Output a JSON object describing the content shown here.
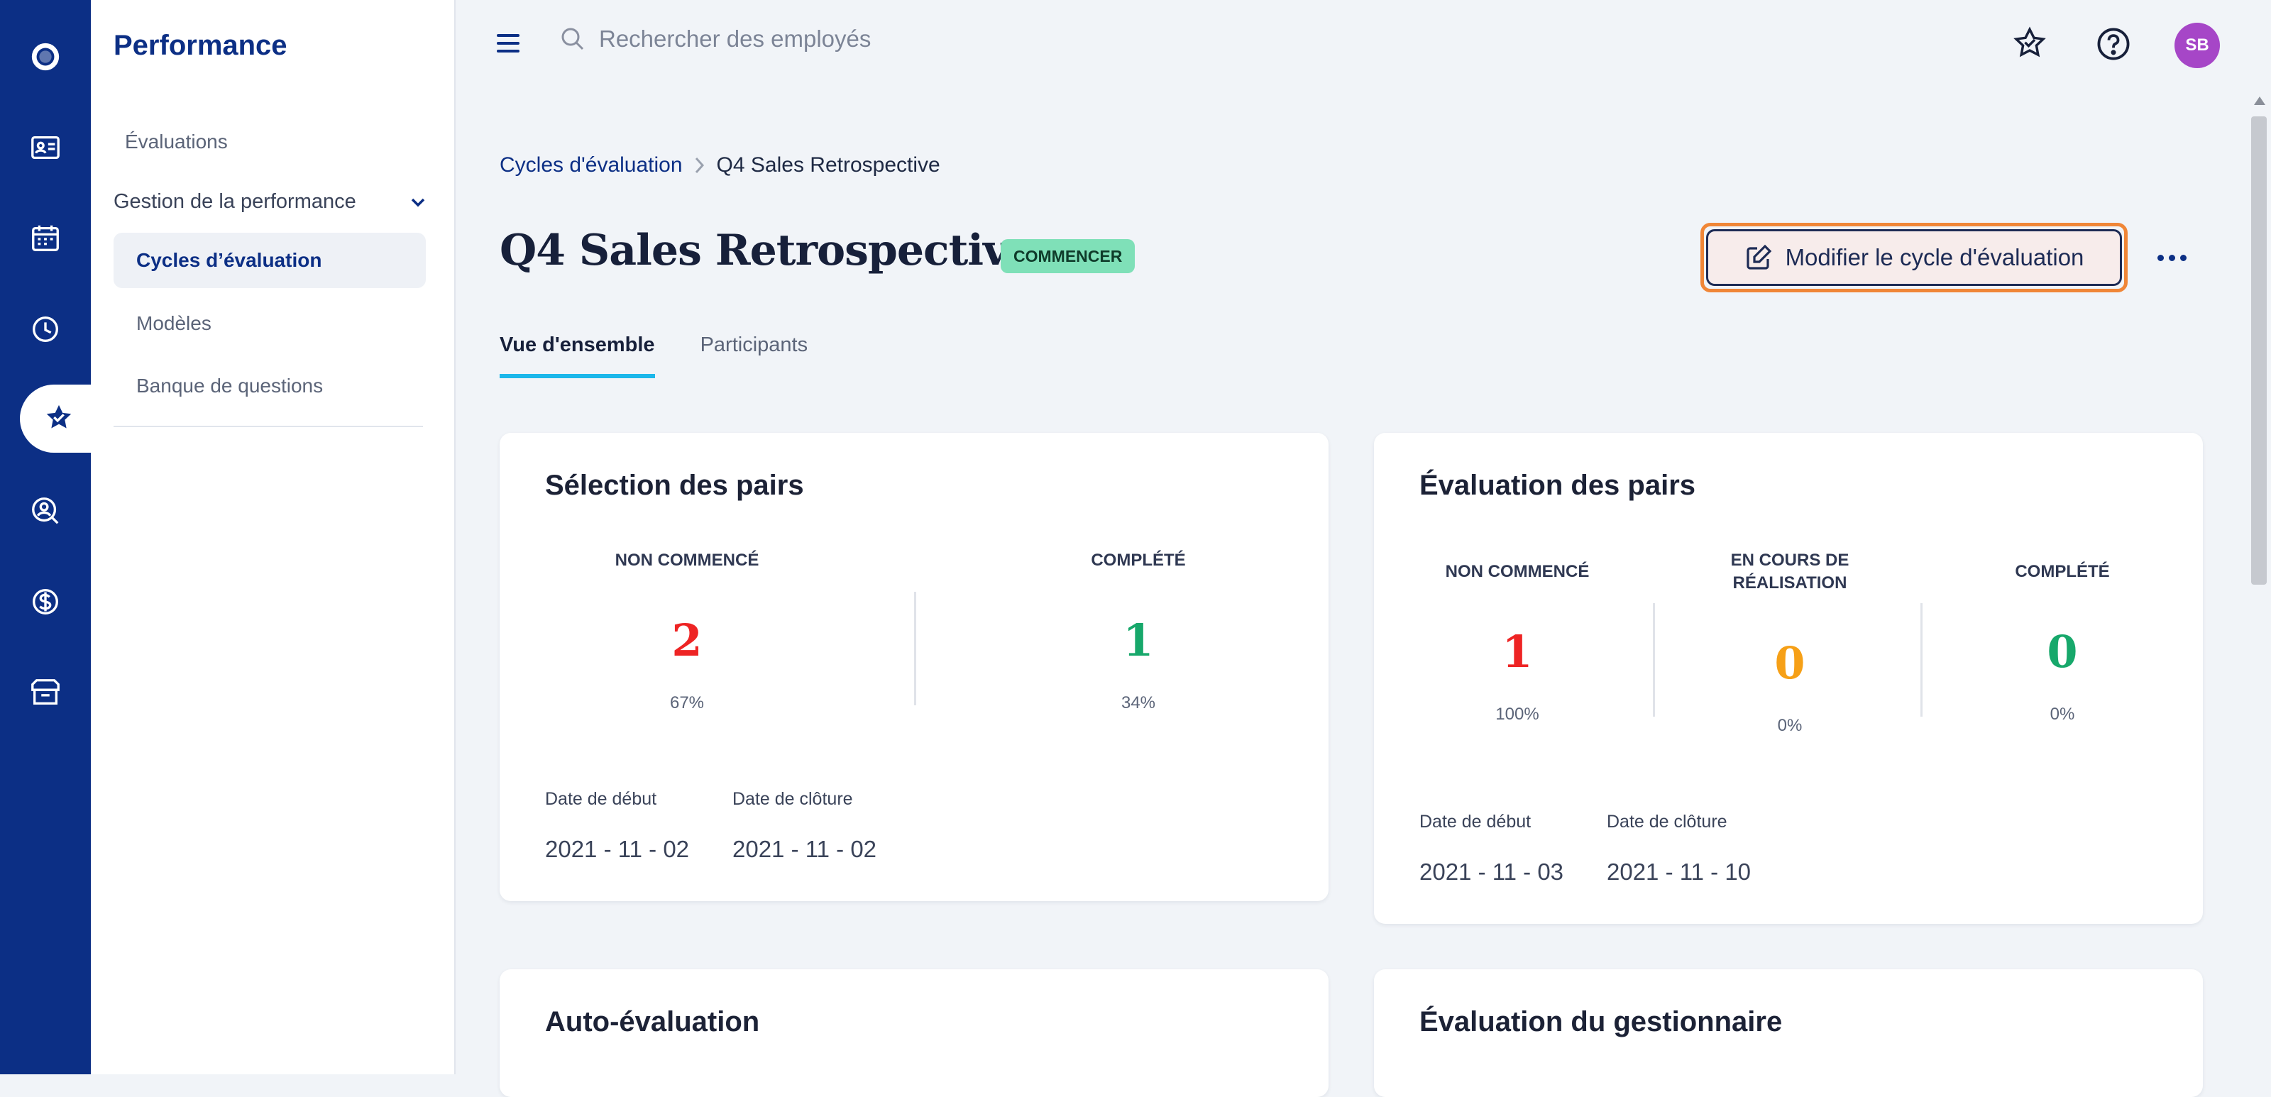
{
  "sidebar": {
    "title": "Performance",
    "items": [
      {
        "label": "Évaluations"
      },
      {
        "label": "Gestion de la performance"
      },
      {
        "label": "Cycles d’évaluation"
      },
      {
        "label": "Modèles"
      },
      {
        "label": "Banque de questions"
      }
    ]
  },
  "topbar": {
    "search_placeholder": "Rechercher des employés",
    "avatar_initials": "SB"
  },
  "breadcrumb": {
    "parent": "Cycles d'évaluation",
    "current": "Q4 Sales Retrospective"
  },
  "page": {
    "title": "Q4 Sales Retrospective",
    "status": "COMMENCER",
    "edit_button": "Modifier le cycle d'évaluation"
  },
  "tabs": [
    {
      "label": "Vue d'ensemble"
    },
    {
      "label": "Participants"
    }
  ],
  "cards": {
    "peer_selection": {
      "title": "Sélection des pairs",
      "stats": [
        {
          "label": "NON COMMENCÉ",
          "value": "2",
          "pct": "67%"
        },
        {
          "label": "COMPLÉTÉ",
          "value": "1",
          "pct": "34%"
        }
      ],
      "start_label": "Date de début",
      "start_date": "2021 - 11 - 02",
      "end_label": "Date de clôture",
      "end_date": "2021 - 11 - 02"
    },
    "peer_review": {
      "title": "Évaluation des pairs",
      "stats": [
        {
          "label": "NON COMMENCÉ",
          "value": "1",
          "pct": "100%"
        },
        {
          "label": "EN COURS DE RÉALISATION",
          "value": "0",
          "pct": "0%"
        },
        {
          "label": "COMPLÉTÉ",
          "value": "0",
          "pct": "0%"
        }
      ],
      "start_label": "Date de début",
      "start_date": "2021 - 11 - 03",
      "end_label": "Date de clôture",
      "end_date": "2021 - 11 - 10"
    },
    "self_review": {
      "title": "Auto-évaluation"
    },
    "manager_review": {
      "title": "Évaluation du gestionnaire"
    }
  },
  "colors": {
    "brand": "#0c2f85",
    "accent_tab": "#1cb7ea",
    "status_badge": "#7fe0b8",
    "focus_outline": "#f08637",
    "not_started": "#ee2424",
    "in_progress": "#f6a017",
    "completed": "#17a86b"
  },
  "icons": {
    "rail": [
      "logo-icon",
      "id-card-icon",
      "calendar-icon",
      "clock-icon",
      "star-badge-icon",
      "person-search-icon",
      "dollar-icon",
      "box-icon"
    ],
    "topbar": [
      "menu-icon",
      "search-icon",
      "star-badge-icon",
      "help-icon"
    ]
  }
}
